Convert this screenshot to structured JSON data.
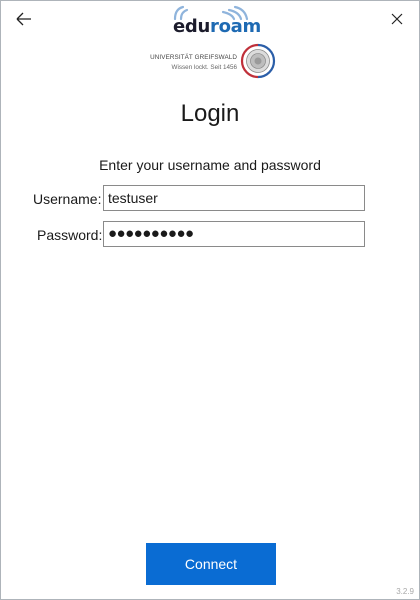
{
  "brand": {
    "logo_a": "edu",
    "logo_b": "roam"
  },
  "institution": {
    "name": "UNIVERSITÄT GREIFSWALD",
    "motto": "Wissen lockt. Seit 1456"
  },
  "title": "Login",
  "subtitle": "Enter your username and password",
  "form": {
    "username_label": "Username:",
    "username_value": "testuser",
    "password_label": "Password:",
    "password_masked": "●●●●●●●●●●"
  },
  "connect_label": "Connect",
  "version": "3.2.9",
  "colors": {
    "accent": "#0a6cd3",
    "brand_blue": "#1e6ab3",
    "brand_red": "#c0303a"
  },
  "icons": {
    "back": "back-arrow-icon",
    "close": "close-icon"
  }
}
